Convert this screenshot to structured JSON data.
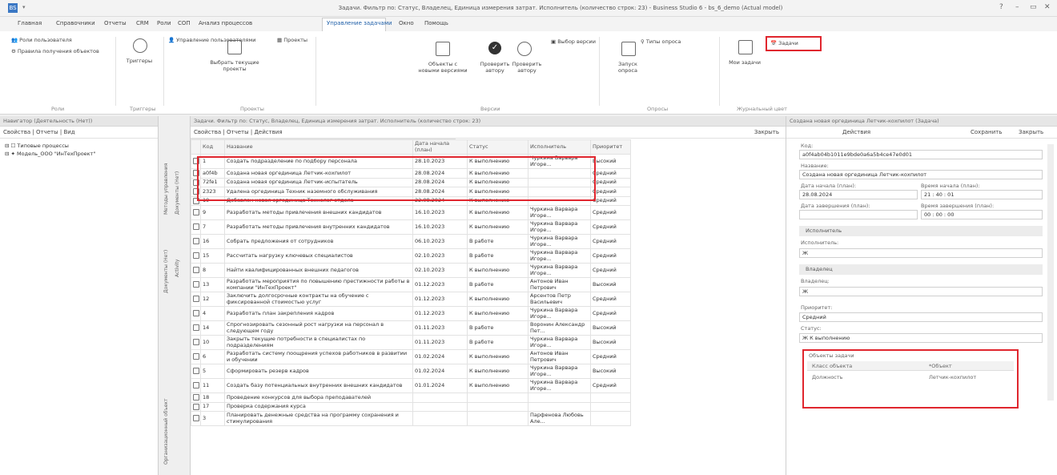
{
  "window": {
    "title": "Задачи. Фильтр по: Статус, Владелец, Единица измерения затрат. Исполнитель (количество строк: 23) - Business Studio 6 - bs_6_demo (Actual model)",
    "app_icon": "BS",
    "min": "–",
    "max": "▭",
    "close": "✕"
  },
  "menu": [
    "Главная",
    "Справочники",
    "Отчеты",
    "CRM",
    "Роли",
    "СОП",
    "Анализ процессов",
    "Управление задачами",
    "Окно",
    "Помощь"
  ],
  "ribbon": {
    "links": [
      "Роли пользователя",
      "Правила получения объектов"
    ],
    "triggers": "Триггеры",
    "user_mgmt": "Управление пользователями",
    "select_projects": "Выбрать текущие проекты",
    "projects": "Проекты",
    "objects_list": "Объекты с новыми версиями",
    "check_author": "Проверить автору",
    "check_exec": "Проверить автору",
    "item_selection": "Выбор версии",
    "launch_survey": "Запуск опроса",
    "survey_types": "Типы опроса",
    "my_tasks": "Мои задачи",
    "tasks": "Задачи",
    "groups": [
      "Роли",
      "Триггеры",
      "Проекты",
      "Версии",
      "Опросы",
      "Журнальный цвет"
    ]
  },
  "left": {
    "header": "Навигатор (Деятельность (Нет))",
    "toolbar": "Свойства | Отчеты | Вид",
    "tree": [
      "Типовые процессы",
      "Модель_ООО \"ИнТехПроект\""
    ]
  },
  "vtabs": [
    "Методы управления",
    "Документы (Нет)",
    "Документы (Нет)",
    "Activity",
    "Организационный объект"
  ],
  "center": {
    "header": "Задачи. Фильтр по: Статус, Владелец, Единица измерения затрат. Исполнитель (количество строк: 23)",
    "toolbar": "Свойства | Отчеты | Действия",
    "close": "Закрыть",
    "columns": [
      "Код",
      "Название",
      "Дата начала (план)",
      "Статус",
      "Исполнитель",
      "Приоритет"
    ],
    "rows": [
      {
        "code": "1",
        "name": "Создать подразделение по подбору персонала",
        "date": "28.10.2023",
        "status": "К выполнению",
        "exec": "Чуркина Варвара Игоре...",
        "prio": "Высокий"
      },
      {
        "code": "a0f4b",
        "name": "Создана новая оргединица Летчик-кохпилот",
        "date": "28.08.2024",
        "status": "К выполнению",
        "exec": "",
        "prio": "Средний"
      },
      {
        "code": "72fe1",
        "name": "Создана новая оргединица Летчик-испытатель",
        "date": "28.08.2024",
        "status": "К выполнению",
        "exec": "",
        "prio": "Средний"
      },
      {
        "code": "2323",
        "name": "Удалена оргединица Техник наземного обслуживания",
        "date": "28.08.2024",
        "status": "К выполнению",
        "exec": "",
        "prio": "Средний"
      },
      {
        "code": "19",
        "name": "Добавлен новая оргединица Технолог отдела",
        "date": "22.08.2024",
        "status": "К выполнению",
        "exec": "",
        "prio": "Средний"
      },
      {
        "code": "9",
        "name": "Разработать методы привлечения внешних кандидатов",
        "date": "16.10.2023",
        "status": "К выполнению",
        "exec": "Чуркина Варвара Игоре...",
        "prio": "Средний"
      },
      {
        "code": "7",
        "name": "Разработать методы привлечения внутренних кандидатов",
        "date": "16.10.2023",
        "status": "К выполнению",
        "exec": "Чуркина Варвара Игоре...",
        "prio": "Средний"
      },
      {
        "code": "16",
        "name": "Собрать предложения от сотрудников",
        "date": "06.10.2023",
        "status": "В работе",
        "exec": "Чуркина Варвара Игоре...",
        "prio": "Средний"
      },
      {
        "code": "15",
        "name": "Рассчитать нагрузку ключевых специалистов",
        "date": "02.10.2023",
        "status": "В работе",
        "exec": "Чуркина Варвара Игоре...",
        "prio": "Средний"
      },
      {
        "code": "8",
        "name": "Найти квалифицированных внешних педагогов",
        "date": "02.10.2023",
        "status": "К выполнению",
        "exec": "Чуркина Варвара Игоре...",
        "prio": "Средний"
      },
      {
        "code": "13",
        "name": "Разработать мероприятия по повышению престижности работы в компании \"ИнТехПроект\"",
        "date": "01.12.2023",
        "status": "В работе",
        "exec": "Антонов Иван Петрович",
        "prio": "Высокий"
      },
      {
        "code": "12",
        "name": "Заключить долгосрочные контракты на обучение с фиксированной стоимостью услуг",
        "date": "01.12.2023",
        "status": "К выполнению",
        "exec": "Арсентов Петр Васильевич",
        "prio": "Средний"
      },
      {
        "code": "4",
        "name": "Разработать план закрепления кадров",
        "date": "01.12.2023",
        "status": "К выполнению",
        "exec": "Чуркина Варвара Игоре...",
        "prio": "Средний"
      },
      {
        "code": "14",
        "name": "Спрогнозировать сезонный рост нагрузки на персонал в следующем году",
        "date": "01.11.2023",
        "status": "В работе",
        "exec": "Воронин Александр Пет...",
        "prio": "Высокий"
      },
      {
        "code": "10",
        "name": "Закрыть текущие потребности в специалистах по подразделениям",
        "date": "01.11.2023",
        "status": "В работе",
        "exec": "Чуркина Варвара Игоре...",
        "prio": "Высокий"
      },
      {
        "code": "6",
        "name": "Разработать систему поощрения успехов работников в развитии и обучении",
        "date": "01.02.2024",
        "status": "К выполнению",
        "exec": "Антонов Иван Петрович",
        "prio": "Средний"
      },
      {
        "code": "5",
        "name": "Сформировать резерв кадров",
        "date": "01.02.2024",
        "status": "К выполнению",
        "exec": "Чуркина Варвара Игоре...",
        "prio": "Высокий"
      },
      {
        "code": "11",
        "name": "Создать базу потенциальных внутренних внешних кандидатов",
        "date": "01.01.2024",
        "status": "К выполнению",
        "exec": "Чуркина Варвара Игоре...",
        "prio": "Средний"
      },
      {
        "code": "18",
        "name": "Проведение конкурсов для выбора преподавателей",
        "date": "",
        "status": "",
        "exec": "",
        "prio": ""
      },
      {
        "code": "17",
        "name": "Проверка содержания курса",
        "date": "",
        "status": "",
        "exec": "",
        "prio": ""
      },
      {
        "code": "3",
        "name": "Планировать денежные средства на программу сохранения и стимулирования",
        "date": "",
        "status": "",
        "exec": "Парфенова Любовь Але...",
        "prio": ""
      }
    ]
  },
  "right": {
    "header": "Создана новая оргединица Летчик-кохпилот (Задача)",
    "toolbar_actions": "Действия",
    "save": "Сохранить",
    "close": "Закрыть",
    "code_label": "Код:",
    "code_value": "a0f4ab04b1011e9bde0a6a5b4ce47e0d01",
    "name_label": "Название:",
    "name_value": "Создана новая оргединица Летчик-кохпилот",
    "start_date_label": "Дата начала (план):",
    "start_date_value": "28.08.2024",
    "start_time_label": "Время начала (план):",
    "start_time_value": "21 : 40 : 01",
    "end_date_label": "Дата завершения (план):",
    "end_date_value": "",
    "end_time_label": "Время завершения (план):",
    "end_time_value": "00 : 00 : 00",
    "exec_section": "Исполнитель",
    "exec_label": "Исполнитель:",
    "exec_value": "Ж",
    "owner_section": "Владелец",
    "owner_label": "Владелец:",
    "owner_value": "Ж",
    "prio_label": "Приоритет:",
    "prio_value": "Средний",
    "status_label": "Статус:",
    "status_value": "Ж К выполнению",
    "objects_title": "Объекты задачи",
    "objects_col1": "Класс объекта",
    "objects_col2": "*Объект",
    "objects_row_class": "Должность",
    "objects_row_obj": "Летчик-кохпилот"
  }
}
